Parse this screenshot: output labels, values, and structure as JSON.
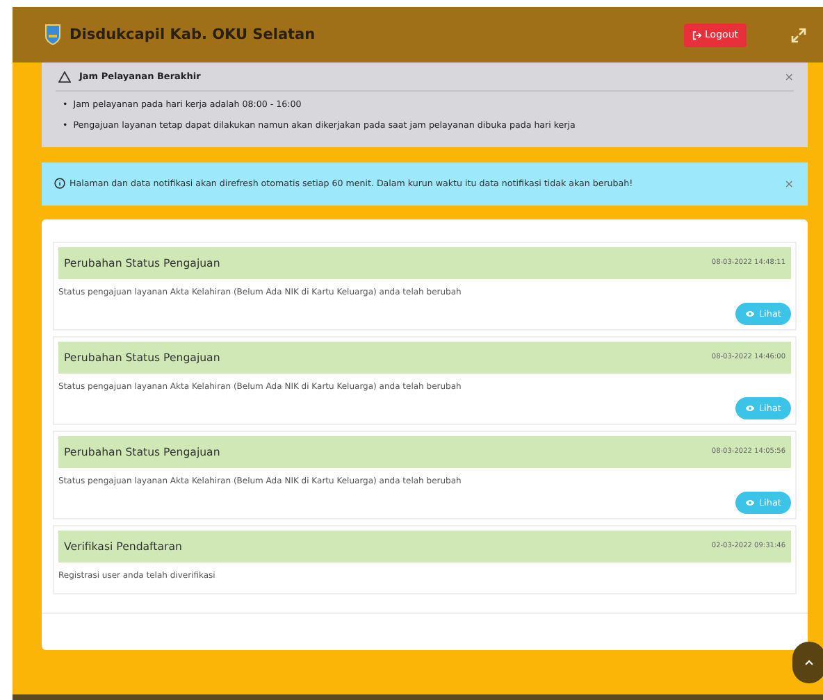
{
  "header": {
    "title": "Disdukcapil Kab. OKU Selatan",
    "logout": "Logout"
  },
  "warning": {
    "title": "Jam Pelayanan Berakhir",
    "close": "×",
    "bullet": "•",
    "items": [
      "Jam pelayanan pada hari kerja adalah 08:00 - 16:00",
      "Pengajuan layanan tetap dapat dilakukan namun akan dikerjakan pada saat jam pelayanan dibuka pada hari kerja"
    ]
  },
  "info": {
    "text": "Halaman dan data notifikasi akan direfresh otomatis setiap 60 menit. Dalam kurun waktu itu data notifikasi tidak akan berubah!",
    "close": "×"
  },
  "notifications": [
    {
      "title": "Perubahan Status Pengajuan",
      "time": "08-03-2022 14:48:11",
      "message": "Status pengajuan layanan Akta Kelahiran (Belum Ada NIK di Kartu Keluarga) anda telah berubah",
      "button": "Lihat"
    },
    {
      "title": "Perubahan Status Pengajuan",
      "time": "08-03-2022 14:46:00",
      "message": "Status pengajuan layanan Akta Kelahiran (Belum Ada NIK di Kartu Keluarga) anda telah berubah",
      "button": "Lihat"
    },
    {
      "title": "Perubahan Status Pengajuan",
      "time": "08-03-2022 14:05:56",
      "message": "Status pengajuan layanan Akta Kelahiran (Belum Ada NIK di Kartu Keluarga) anda telah berubah",
      "button": "Lihat"
    },
    {
      "title": "Verifikasi Pendaftaran",
      "time": "02-03-2022 09:31:46",
      "message": "Registrasi user anda telah diverifikasi"
    }
  ]
}
